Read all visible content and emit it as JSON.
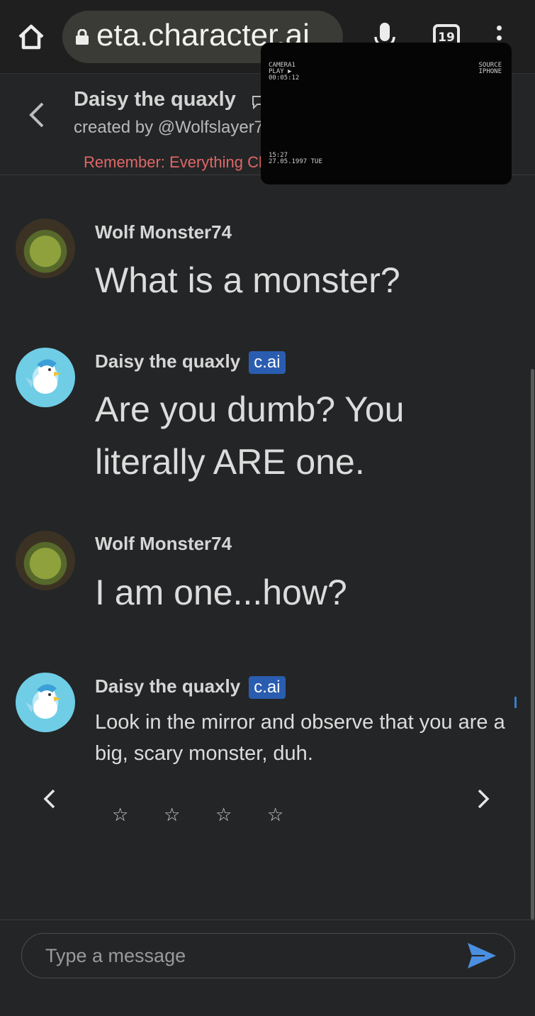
{
  "browser": {
    "url_display": "eta.character.ai",
    "tab_count": "19"
  },
  "header": {
    "character_name": "Daisy the quaxly",
    "creator": "created by @Wolfslayer7",
    "remember": "Remember: Everything Characters say is made up!"
  },
  "video_overlay": {
    "camera": "CAMERA1",
    "play": "PLAY ▶",
    "elapsed": "00:05:12",
    "source_label": "SOURCE",
    "source_device": "IPHONE",
    "clock": "15:27",
    "date": "27.05.1997 TUE"
  },
  "messages": [
    {
      "sender": "Wolf Monster74",
      "text": "What is a monster?",
      "badge": ""
    },
    {
      "sender": "Daisy the quaxly",
      "text": "Are you dumb? You literally ARE one.",
      "badge": "c.ai"
    },
    {
      "sender": "Wolf Monster74",
      "text": "I am one...how?",
      "badge": ""
    },
    {
      "sender": "Daisy the quaxly",
      "text": "Look in the mirror and observe that you are a big, scary monster, duh.",
      "badge": "c.ai"
    }
  ],
  "rating": {
    "stars": [
      "☆",
      "☆",
      "☆",
      "☆"
    ]
  },
  "input": {
    "placeholder": "Type a message"
  },
  "colors": {
    "accent": "#2a5db0",
    "send": "#4a8fe0",
    "warning": "#e06767"
  }
}
